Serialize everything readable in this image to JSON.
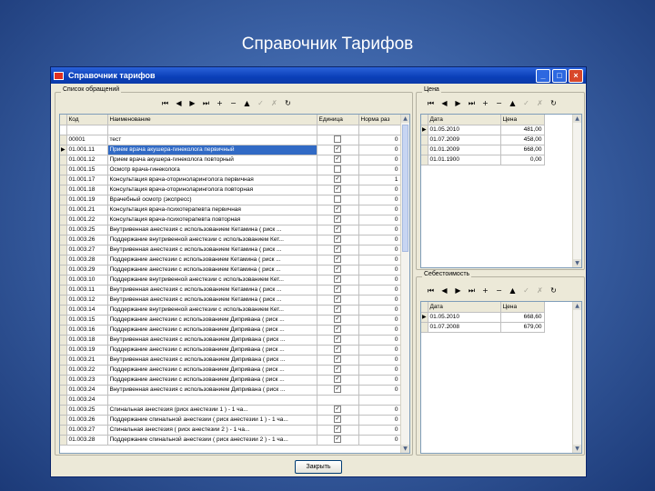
{
  "slide_title": "Справочник Тарифов",
  "window": {
    "title": "Справочник тарифов",
    "minimize": "_",
    "maximize": "□",
    "close": "×"
  },
  "services": {
    "group_label": "Список обращений",
    "toolbar": [
      "⏮",
      "◀",
      "▶",
      "⏭",
      "+",
      "−",
      "▲",
      "✓",
      "✗",
      "↻"
    ],
    "columns": [
      "Код",
      "Наименование",
      "Единица",
      "Норма раз"
    ],
    "rows": [
      {
        "code": "00001",
        "name": "тест",
        "unit": false,
        "norm": "0",
        "selected": false,
        "current": false
      },
      {
        "code": "01.001.11",
        "name": "Прием врача акушера-гинеколога первичный",
        "unit": true,
        "norm": "0",
        "selected": true,
        "current": true
      },
      {
        "code": "01.001.12",
        "name": "Прием врача акушера-гинеколога повторный",
        "unit": true,
        "norm": "0",
        "selected": false,
        "current": false
      },
      {
        "code": "01.001.15",
        "name": "Осмотр врача-гинеколога",
        "unit": false,
        "norm": "0",
        "selected": false,
        "current": false
      },
      {
        "code": "01.001.17",
        "name": "Консультация врача-оториноларинголога первичная",
        "unit": true,
        "norm": "1",
        "selected": false,
        "current": false
      },
      {
        "code": "01.001.18",
        "name": "Консультация врача-оториноларинголога повторная",
        "unit": true,
        "norm": "0",
        "selected": false,
        "current": false
      },
      {
        "code": "01.001.19",
        "name": "Врачебный осмотр (экспресс)",
        "unit": false,
        "norm": "0",
        "selected": false,
        "current": false
      },
      {
        "code": "01.001.21",
        "name": "Консультация врача-психотерапевта первичная",
        "unit": true,
        "norm": "0",
        "selected": false,
        "current": false
      },
      {
        "code": "01.001.22",
        "name": "Консультация врача-психотерапевта повторная",
        "unit": true,
        "norm": "0",
        "selected": false,
        "current": false
      },
      {
        "code": "01.003.25",
        "name": "Внутривенная анестезия с использованием Кетамина ( риск ...",
        "unit": true,
        "norm": "0",
        "selected": false,
        "current": false
      },
      {
        "code": "01.003.26",
        "name": "Поддержание внутривенной анестезии с использованием Кет...",
        "unit": true,
        "norm": "0",
        "selected": false,
        "current": false
      },
      {
        "code": "01.003.27",
        "name": "Внутривенная анестезия с использованием Кетамина ( риск ...",
        "unit": true,
        "norm": "0",
        "selected": false,
        "current": false
      },
      {
        "code": "01.003.28",
        "name": "Поддержание анестезии с использованием Кетамина ( риск ...",
        "unit": true,
        "norm": "0",
        "selected": false,
        "current": false
      },
      {
        "code": "01.003.29",
        "name": "Поддержание анестезии с использованием Кетамина ( риск ...",
        "unit": true,
        "norm": "0",
        "selected": false,
        "current": false
      },
      {
        "code": "01.003.10",
        "name": "Поддержание внутривенной анестезии с использованием Кет...",
        "unit": true,
        "norm": "0",
        "selected": false,
        "current": false
      },
      {
        "code": "01.003.11",
        "name": "Внутривенная анестезия с использованием Кетамина ( риск ...",
        "unit": true,
        "norm": "0",
        "selected": false,
        "current": false
      },
      {
        "code": "01.003.12",
        "name": "Внутривенная анестезия с использованием Кетамина ( риск ...",
        "unit": true,
        "norm": "0",
        "selected": false,
        "current": false
      },
      {
        "code": "01.003.14",
        "name": "Поддержание внутривенной анестезии с использованием Кет...",
        "unit": true,
        "norm": "0",
        "selected": false,
        "current": false
      },
      {
        "code": "01.003.15",
        "name": "Поддержание анестезии с использованием Дипривана ( риск ...",
        "unit": true,
        "norm": "0",
        "selected": false,
        "current": false
      },
      {
        "code": "01.003.16",
        "name": "Поддержание анестезии с использованием Дипривана ( риск ...",
        "unit": true,
        "norm": "0",
        "selected": false,
        "current": false
      },
      {
        "code": "01.003.18",
        "name": "Внутривенная анестезия с использованием Дипривана ( риск ...",
        "unit": true,
        "norm": "0",
        "selected": false,
        "current": false
      },
      {
        "code": "01.003.19",
        "name": "Поддержание анестезии с использованием Дипривана ( риск ...",
        "unit": true,
        "norm": "0",
        "selected": false,
        "current": false
      },
      {
        "code": "01.003.21",
        "name": "Внутривенная анестезия с использованием Дипривана ( риск ...",
        "unit": true,
        "norm": "0",
        "selected": false,
        "current": false
      },
      {
        "code": "01.003.22",
        "name": "Поддержание анестезии с использованием Дипривана ( риск ...",
        "unit": true,
        "norm": "0",
        "selected": false,
        "current": false
      },
      {
        "code": "01.003.23",
        "name": "Поддержание анестезии с использованием Дипривана ( риск ...",
        "unit": true,
        "norm": "0",
        "selected": false,
        "current": false
      },
      {
        "code": "01.003.24",
        "name": "Внутривенная анестезия с использованием Дипривана ( риск ...",
        "unit": true,
        "norm": "0",
        "selected": false,
        "current": false
      },
      {
        "code": "01.003.24",
        "name": "",
        "unit": false,
        "norm": "",
        "selected": false,
        "current": false
      },
      {
        "code": "01.003.25",
        "name": "Спинальная анестезия (риск анестезии 1 ) - 1 ча...",
        "unit": true,
        "norm": "0",
        "selected": false,
        "current": false
      },
      {
        "code": "01.003.26",
        "name": "Поддержание спинальной анестезии ( риск анестезии 1 ) - 1 ча...",
        "unit": true,
        "norm": "0",
        "selected": false,
        "current": false
      },
      {
        "code": "01.003.27",
        "name": "Спинальная анестезия ( риск анестезии 2 ) - 1 ча...",
        "unit": true,
        "norm": "0",
        "selected": false,
        "current": false
      },
      {
        "code": "01.003.28",
        "name": "Поддержание спинальной анестезии ( риск анестезии 2 ) - 1 ча...",
        "unit": true,
        "norm": "0",
        "selected": false,
        "current": false
      }
    ]
  },
  "price": {
    "group_label": "Цена",
    "toolbar": [
      "⏮",
      "◀",
      "▶",
      "⏭",
      "+",
      "−",
      "▲",
      "✓",
      "✗",
      "↻"
    ],
    "columns": [
      "Дата",
      "Цена"
    ],
    "rows": [
      {
        "date": "01.05.2010",
        "value": "481,00",
        "current": true
      },
      {
        "date": "01.07.2009",
        "value": "458,00",
        "current": false
      },
      {
        "date": "01.01.2009",
        "value": "668,00",
        "current": false
      },
      {
        "date": "01.01.1900",
        "value": "0,00",
        "current": false
      }
    ]
  },
  "cost": {
    "group_label": "Себестоимость",
    "toolbar": [
      "⏮",
      "◀",
      "▶",
      "⏭",
      "+",
      "−",
      "▲",
      "✓",
      "✗",
      "↻"
    ],
    "columns": [
      "Дата",
      "Цена"
    ],
    "rows": [
      {
        "date": "01.05.2010",
        "value": "668,60",
        "current": true
      },
      {
        "date": "01.07.2008",
        "value": "679,00",
        "current": false
      }
    ]
  },
  "close_button": "Закрыть"
}
